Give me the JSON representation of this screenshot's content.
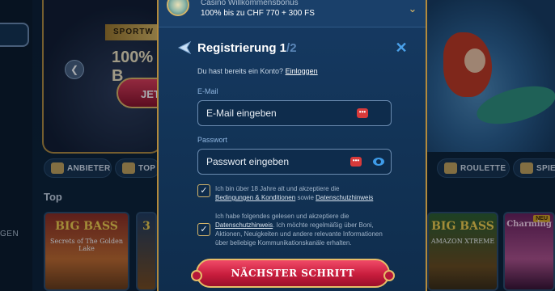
{
  "background": {
    "promo": {
      "ribbon": "SPORTW",
      "headline": "100% B",
      "button": "JET"
    },
    "categories": [
      {
        "label": "ANBIETER",
        "icon": "scroll-icon"
      },
      {
        "label": "TOP",
        "icon": "ship-icon"
      },
      {
        "label": "ROULETTE",
        "icon": "roulette-icon"
      },
      {
        "label": "SPIELS",
        "icon": "shell-icon"
      }
    ],
    "section_title": "Top",
    "side_nav_label": "GEN",
    "games": [
      {
        "title": "BIG BASS",
        "subtitle": "Secrets of The Golden Lake"
      },
      {
        "title": "3",
        "subtitle": ""
      },
      {
        "title": "BIG BASS",
        "subtitle": "AMAZON XTREME"
      },
      {
        "title": "Charming",
        "subtitle": "",
        "badge": "NEU"
      }
    ]
  },
  "bonus": {
    "title": "Casino Willkommensbonus",
    "amount": "100% bis zu CHF 770 + 300 FS"
  },
  "registration": {
    "title": "Registrierung 1",
    "step_sep": "/",
    "step_total": "2",
    "login_prompt": "Du hast bereits ein Konto?",
    "login_link": "Einloggen",
    "email_label": "E-Mail",
    "email_placeholder": "E-Mail eingeben",
    "password_label": "Passwort",
    "password_placeholder": "Passwort eingeben",
    "terms": {
      "text_before": "Ich bin über 18 Jahre alt und akzeptiere die",
      "link1": "Bedingungen & Konditionen",
      "middle": "sowie",
      "link2": "Datenschutzhinweis",
      "checked": true
    },
    "marketing": {
      "text_before": "Ich habe folgendes gelesen und akzeptiere die",
      "link": "Datenschutzhinweis",
      "text_after": ". Ich möchte regelmäßig über Boni, Aktionen, Neuigkeiten und andere relevante Informationen über beliebige Kommunikationskanäle erhalten.",
      "checked": true
    },
    "next_button": "NÄCHSTER SCHRITT"
  },
  "colors": {
    "modal_bg": "#163a63",
    "gold_border": "#b38a3c",
    "accent_blue": "#4aa0e8",
    "cta_red": "#c81d3d"
  }
}
